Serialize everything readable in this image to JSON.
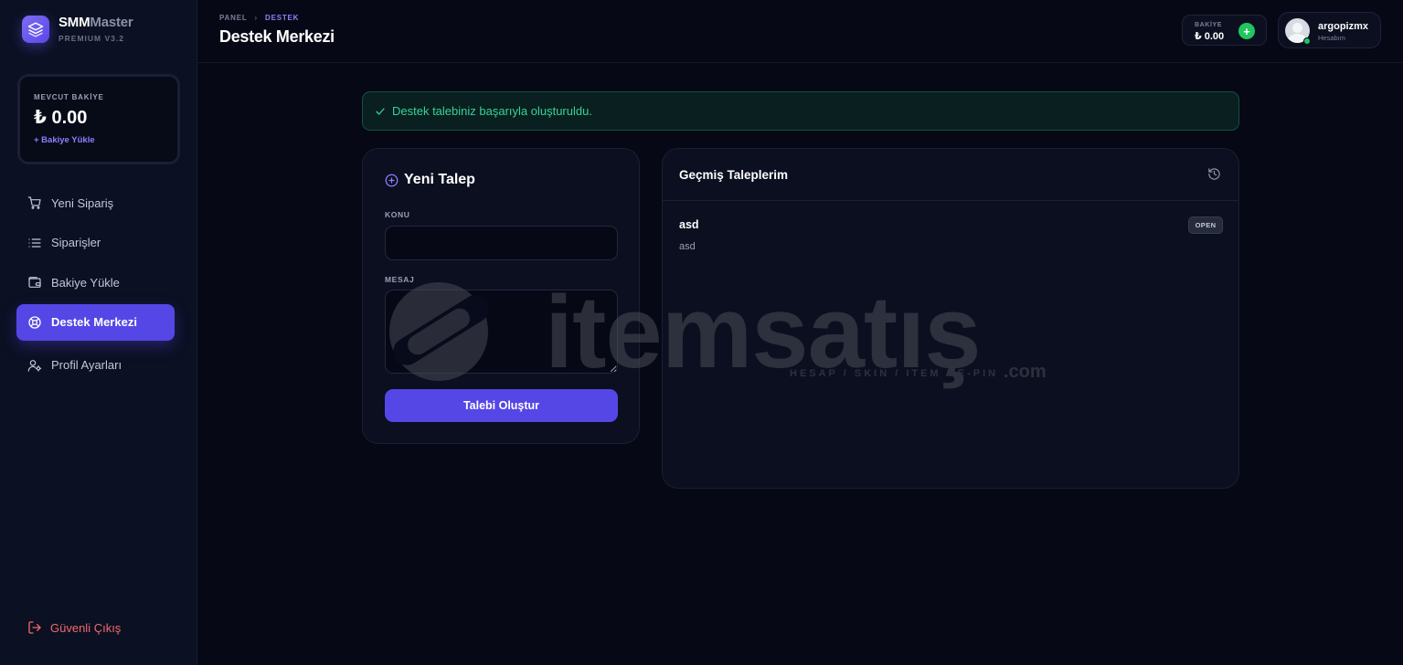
{
  "brand": {
    "name_bold": "SMM",
    "name_rest": "Master",
    "subtitle": "PREMIUM V3.2"
  },
  "balance_card": {
    "label": "MEVCUT BAKİYE",
    "value": "₺ 0.00",
    "load_link": "+ Bakiye Yükle"
  },
  "nav": {
    "items": [
      {
        "label": "Yeni Sipariş",
        "icon": "cart-icon",
        "active": false
      },
      {
        "label": "Siparişler",
        "icon": "list-icon",
        "active": false
      },
      {
        "label": "Bakiye Yükle",
        "icon": "wallet-icon",
        "active": false
      },
      {
        "label": "Destek Merkezi",
        "icon": "lifebuoy-icon",
        "active": true
      },
      {
        "label": "Profil Ayarları",
        "icon": "user-settings-icon",
        "active": false
      }
    ],
    "logout": "Güvenli Çıkış"
  },
  "header": {
    "breadcrumb": [
      "PANEL",
      "DESTEK"
    ],
    "title": "Destek Merkezi",
    "balance_label": "BAKİYE",
    "balance_value": "₺ 0.00",
    "balance_plus": "+",
    "account_name": "argopizmx",
    "account_sub": "Hesabım"
  },
  "alert": {
    "text": "Destek talebiniz başarıyla oluşturuldu."
  },
  "new_ticket": {
    "title": "Yeni Talep",
    "subject_label": "KONU",
    "subject_value": "",
    "message_label": "MESAJ",
    "message_value": "",
    "submit_label": "Talebi Oluştur"
  },
  "history": {
    "title": "Geçmiş Taleplerim",
    "tickets": [
      {
        "subject": "asd",
        "message": "asd",
        "status": "OPEN"
      }
    ]
  },
  "watermark": {
    "text": "itemsatış",
    "sub": "HESAP / SKIN / ITEM / E-PIN",
    "com": ".com"
  },
  "colors": {
    "accent": "#5546e6",
    "success": "#34d399",
    "danger": "#f06a6a",
    "background": "#060816",
    "card": "#0b0f20"
  }
}
